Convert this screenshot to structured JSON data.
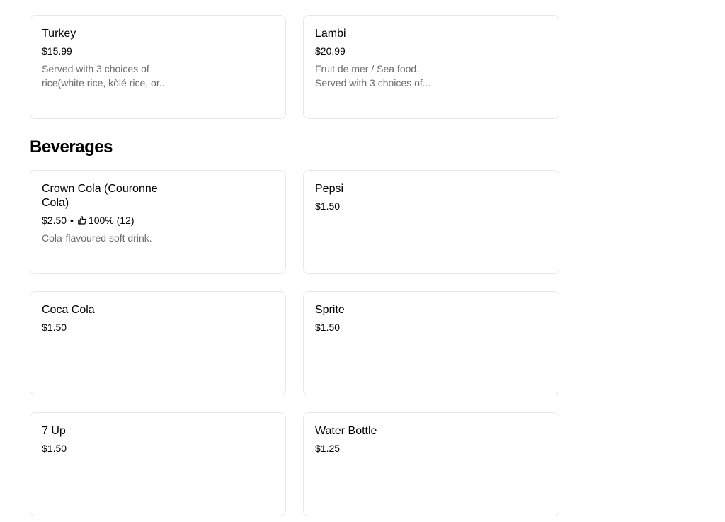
{
  "entrees": {
    "items": [
      {
        "name": "Turkey",
        "price": "$15.99",
        "description": "Served with 3 choices of\nrice(white rice, kòlé rice, or..."
      },
      {
        "name": "Lambi",
        "price": "$20.99",
        "description": "Fruit de mer / Sea food.\nServed with 3 choices of..."
      }
    ]
  },
  "beverages": {
    "title": "Beverages",
    "items": [
      {
        "name": "Crown Cola (Couronne Cola)",
        "price": "$2.50",
        "separator": "•",
        "rating_icon": "thumbs-up-icon",
        "rating": "100% (12)",
        "description": "Cola-flavoured soft drink."
      },
      {
        "name": "Pepsi",
        "price": "$1.50"
      },
      {
        "name": "Coca Cola",
        "price": "$1.50"
      },
      {
        "name": "Sprite",
        "price": "$1.50"
      },
      {
        "name": "7 Up",
        "price": "$1.50"
      },
      {
        "name": "Water Bottle",
        "price": "$1.25"
      }
    ]
  }
}
